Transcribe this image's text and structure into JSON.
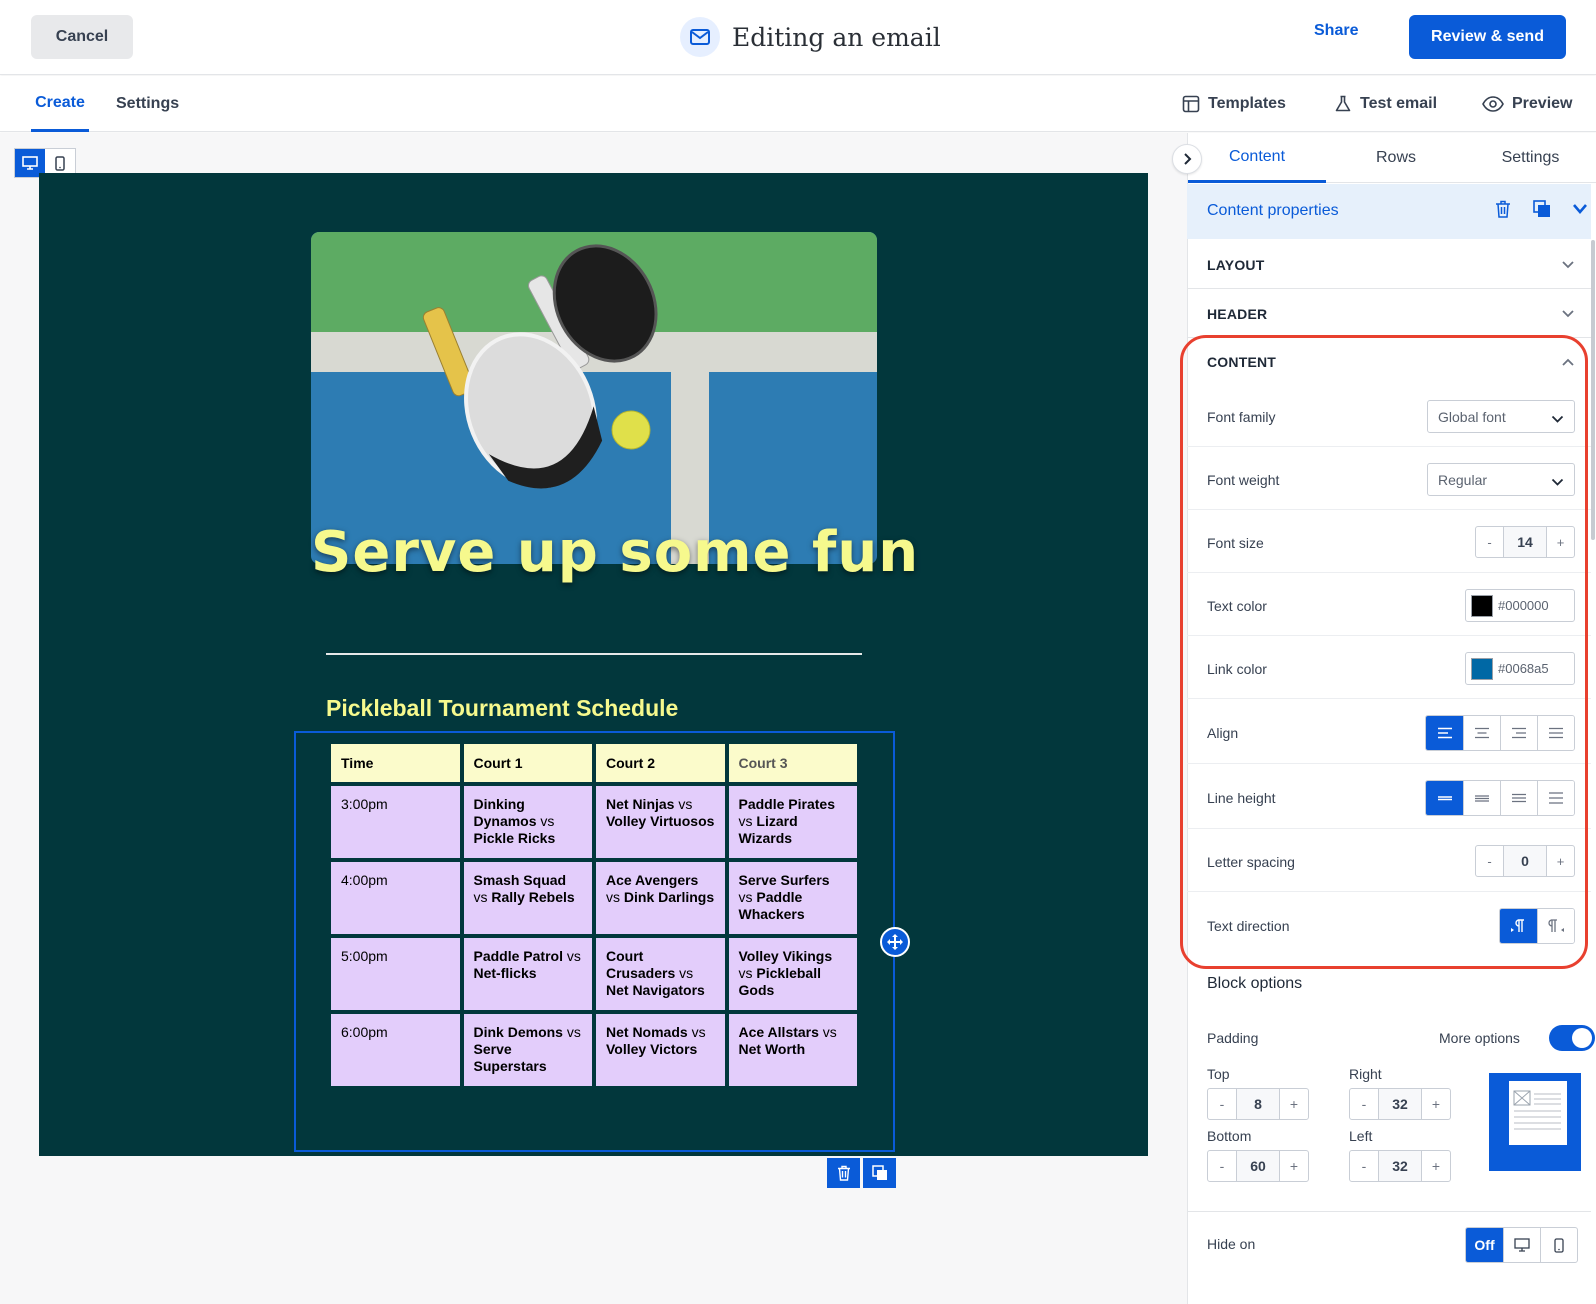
{
  "topbar": {
    "cancel_label": "Cancel",
    "title": "Editing an email",
    "share_label": "Share",
    "review_label": "Review & send"
  },
  "subbar": {
    "tabs": [
      {
        "label": "Create",
        "active": true
      },
      {
        "label": "Settings",
        "active": false
      }
    ],
    "tools": {
      "templates": "Templates",
      "test_email": "Test email",
      "preview": "Preview"
    }
  },
  "email": {
    "headline": "Serve up some fun",
    "schedule_title": "Pickleball Tournament Schedule",
    "table": {
      "headers": [
        "Time",
        "Court 1",
        "Court 2",
        "Court 3"
      ],
      "rows": [
        [
          "3:00pm",
          [
            "Dinking",
            "Dynamos",
            " vs ",
            "Pickle Ricks"
          ],
          [
            "Net Ninjas",
            " vs ",
            "Volley Virtuosos"
          ],
          [
            "Paddle Pirates",
            " vs ",
            "Lizard Wizards"
          ]
        ],
        [
          "4:00pm",
          [
            "Smash Squad",
            " vs ",
            "Rally Rebels"
          ],
          [
            "Ace Avengers",
            " vs ",
            "Dink Darlings"
          ],
          [
            "Serve Surfers",
            " vs ",
            "Paddle Whackers"
          ]
        ],
        [
          "5:00pm",
          [
            "Paddle Patrol",
            " vs ",
            "Net-flicks"
          ],
          [
            "Court Crusaders",
            " vs ",
            "Net Navigators"
          ],
          [
            "Volley Vikings",
            " vs ",
            "Pickleball Gods"
          ]
        ],
        [
          "6:00pm",
          [
            "Dink Demons",
            " vs ",
            "Serve Superstars"
          ],
          [
            "Net Nomads",
            " vs ",
            "Volley Victors"
          ],
          [
            "Ace Allstars",
            " vs ",
            "Net Worth"
          ]
        ]
      ]
    }
  },
  "panel": {
    "tabs": [
      "Content",
      "Rows",
      "Settings"
    ],
    "active_tab": "Content",
    "content_properties": "Content properties",
    "sections": {
      "layout": "LAYOUT",
      "header": "HEADER",
      "content": "CONTENT"
    },
    "fields": {
      "font_family": {
        "label": "Font family",
        "value": "Global font"
      },
      "font_weight": {
        "label": "Font weight",
        "value": "Regular"
      },
      "font_size": {
        "label": "Font size",
        "value": "14",
        "minus": "-",
        "plus": "+"
      },
      "text_color": {
        "label": "Text color",
        "value": "#000000",
        "swatch": "#000000"
      },
      "link_color": {
        "label": "Link color",
        "value": "#0068a5",
        "swatch": "#0068a5"
      },
      "align": {
        "label": "Align",
        "selected": "left"
      },
      "line_height": {
        "label": "Line height",
        "selected": "first"
      },
      "letter_spacing": {
        "label": "Letter spacing",
        "value": "0",
        "minus": "-",
        "plus": "+"
      },
      "text_direction": {
        "label": "Text direction",
        "selected": "ltr"
      }
    },
    "block_options": {
      "title": "Block options",
      "padding_label": "Padding",
      "more_options_label": "More options",
      "more_options_on": true,
      "top": {
        "label": "Top",
        "value": "8"
      },
      "right": {
        "label": "Right",
        "value": "32"
      },
      "bottom": {
        "label": "Bottom",
        "value": "60"
      },
      "left": {
        "label": "Left",
        "value": "32"
      },
      "minus": "-",
      "plus": "+",
      "hide_on_label": "Hide on",
      "hide_on_off": "Off"
    }
  },
  "colors": {
    "accent": "#0a5bd8",
    "email_bg": "#02373c",
    "headline": "#f6f98d",
    "table_header": "#fbfbcb",
    "table_cell": "#e3cdfb",
    "highlight": "#e8402f"
  }
}
